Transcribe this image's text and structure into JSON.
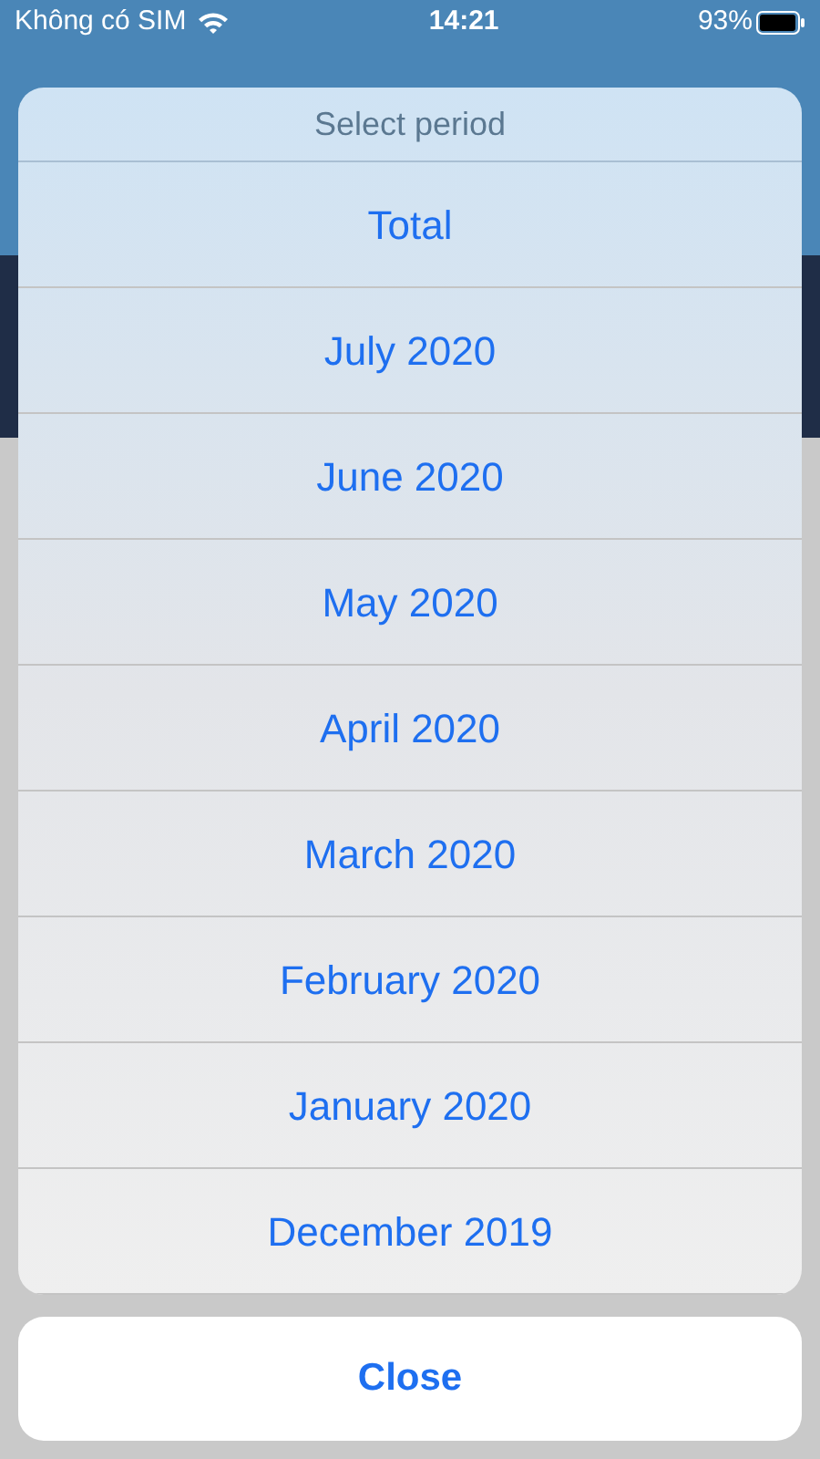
{
  "status_bar": {
    "carrier": "Không có SIM",
    "time": "14:21",
    "battery": "93%"
  },
  "action_sheet": {
    "title": "Select period",
    "options": [
      "Total",
      "July 2020",
      "June 2020",
      "May 2020",
      "April 2020",
      "March 2020",
      "February 2020",
      "January 2020",
      "December 2019"
    ],
    "cancel": "Close"
  }
}
